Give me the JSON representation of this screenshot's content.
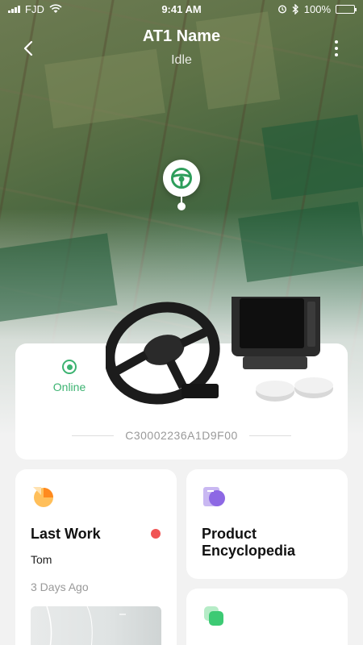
{
  "status_bar": {
    "carrier": "FJD",
    "time": "9:41 AM",
    "battery": "100%",
    "icons": [
      "signal-icon",
      "wifi-icon",
      "alarm-icon",
      "bluetooth-icon",
      "battery-icon"
    ]
  },
  "header": {
    "title": "AT1 Name",
    "subtitle": "Idle",
    "back_icon": "chevron-left-icon",
    "menu_icon": "more-vertical-icon"
  },
  "map": {
    "marker_icon": "steering-wheel-icon"
  },
  "device": {
    "status_label": "Online",
    "status_color": "#3cb371",
    "serial": "C30002236A1D9F00"
  },
  "cards": {
    "last_work": {
      "title": "Last Work",
      "user": "Tom",
      "time": "3 Days Ago",
      "indicator_color": "#f05454"
    },
    "encyclopedia": {
      "title": "Product Encyclopedia"
    }
  },
  "colors": {
    "accent_green": "#3cb371",
    "alert_red": "#f05454",
    "background": "#f2f2f2"
  }
}
